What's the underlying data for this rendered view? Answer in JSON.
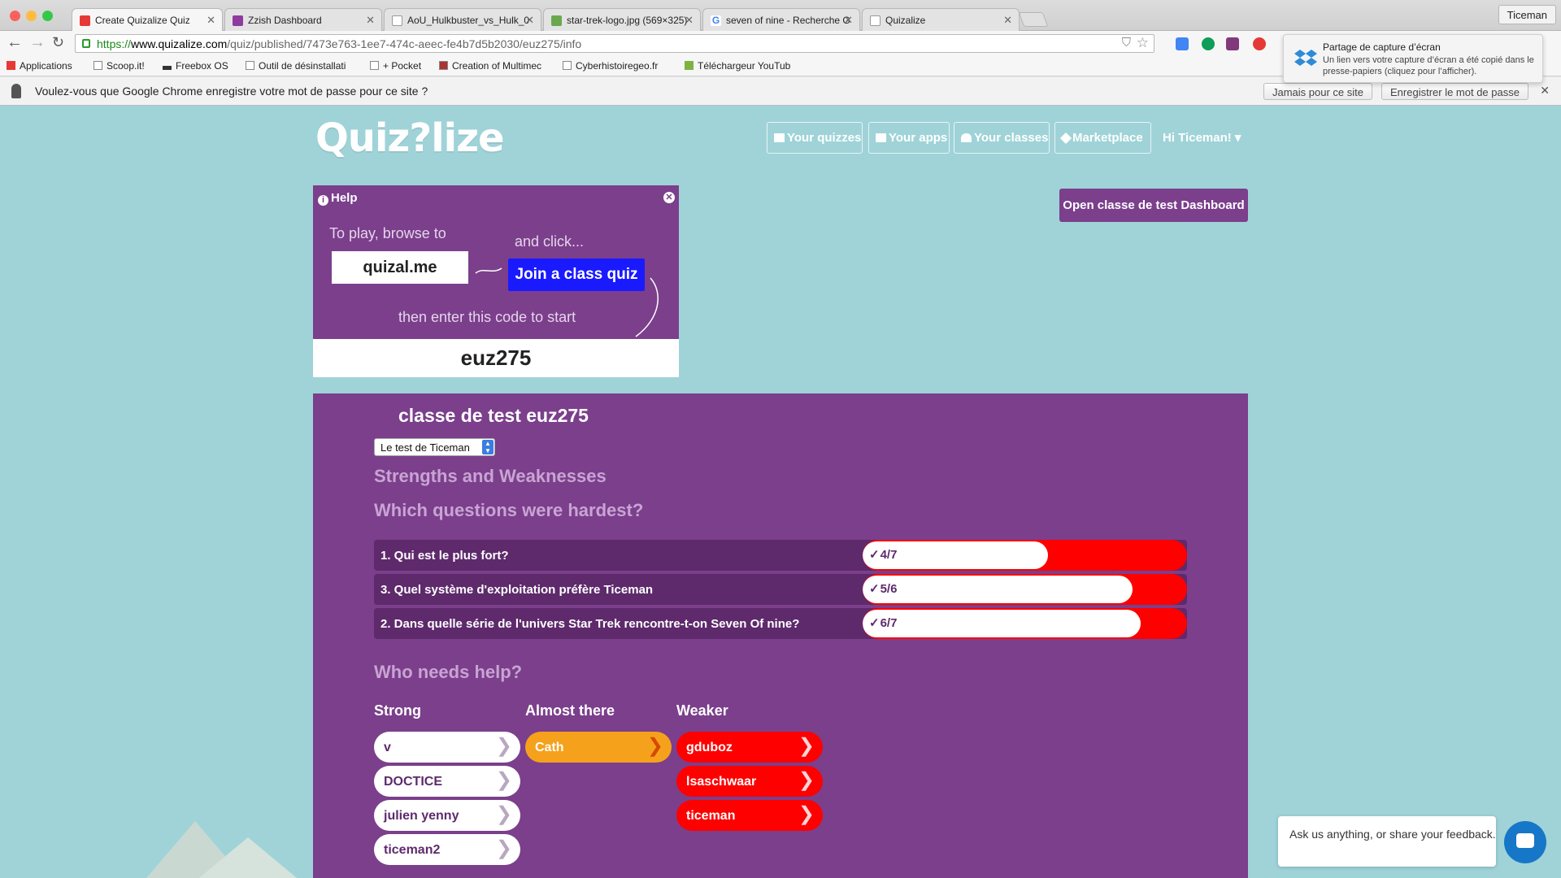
{
  "browser": {
    "tabs": [
      {
        "label": "Create Quizalize Quiz",
        "active": true,
        "favicon_color": "#e53935"
      },
      {
        "label": "Zzish Dashboard",
        "active": false,
        "favicon_color": "#8e3a9e"
      },
      {
        "label": "AoU_Hulkbuster_vs_Hulk_0",
        "active": false,
        "favicon_color": "#cccccc"
      },
      {
        "label": "star-trek-logo.jpg (569×325)",
        "active": false,
        "favicon_color": "#6aa84f"
      },
      {
        "label": "seven of nine - Recherche G",
        "active": false,
        "favicon_color": "#4285f4"
      },
      {
        "label": "Quizalize",
        "active": false,
        "favicon_color": "#cccccc"
      }
    ],
    "profile": "Ticeman",
    "url": {
      "scheme": "https://",
      "host": "www.quizalize.com",
      "path": "/quiz/published/7473e763-1ee7-474c-aeec-fe4b7d5b2030/euz275/info"
    },
    "bookmarks": [
      "Applications",
      "Scoop.it!",
      "Freebox OS",
      "Outil de désinstallati",
      "+ Pocket",
      "Creation of Multimec",
      "Cyberhistoiregeo.fr",
      "Téléchargeur YouTub"
    ],
    "infobar": {
      "message": "Voulez-vous que Google Chrome enregistre votre mot de passe pour ce site ?",
      "never": "Jamais pour ce site",
      "save": "Enregistrer le mot de passe"
    },
    "notification": {
      "title": "Partage de capture d’écran",
      "body": "Un lien vers votre capture d’écran a été copié dans le presse-papiers (cliquez pour l’afficher)."
    }
  },
  "header": {
    "logo": "Quiz?lize",
    "nav": [
      "Your quizzes",
      "Your apps",
      "Your classes",
      "Marketplace"
    ],
    "user": "Hi Ticeman! ▾",
    "dashboard_button": "Open classe de test Dashboard"
  },
  "help": {
    "title": "Help",
    "browse": "To play, browse to",
    "url": "quizal.me",
    "and_click": "and click...",
    "join": "Join a class quiz",
    "then": "then enter this code to start",
    "code": "euz275"
  },
  "report": {
    "title": "classe de test euz275",
    "quiz_select": "Le test de Ticeman",
    "strengths_heading": "Strengths and Weaknesses",
    "hardest_heading": "Which questions were hardest?",
    "questions": [
      {
        "label": "1. Qui est le plus fort?",
        "score": "4/7",
        "fraction": 0.571
      },
      {
        "label": "3. Quel système d'exploitation préfère Ticeman",
        "score": "5/6",
        "fraction": 0.833
      },
      {
        "label": "2. Dans quelle série de l'univers Star Trek rencontre-t-on Seven Of nine?",
        "score": "6/7",
        "fraction": 0.857
      }
    ],
    "help_heading": "Who needs help?",
    "columns": {
      "strong": {
        "label": "Strong",
        "students": [
          "v",
          "DOCTICE",
          "julien yenny",
          "ticeman2"
        ]
      },
      "almost": {
        "label": "Almost there",
        "students": [
          "Cath"
        ]
      },
      "weaker": {
        "label": "Weaker",
        "students": [
          "gduboz",
          "lsaschwaar",
          "ticeman"
        ]
      }
    }
  },
  "chat": {
    "prompt": "Ask us anything, or share your feedback."
  },
  "colors": {
    "bg": "#9fd3d8",
    "purple": "#7b3f8c",
    "dark_purple": "#5e2a6c",
    "red": "#ff0000",
    "orange": "#f5a11c",
    "join_blue": "#1a1aff"
  }
}
